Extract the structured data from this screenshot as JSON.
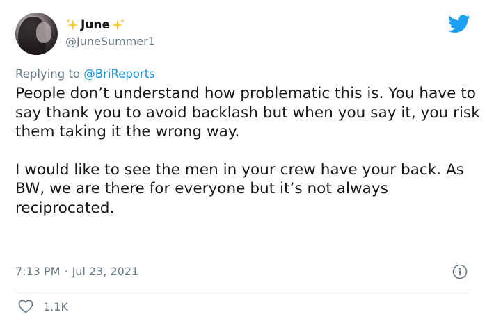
{
  "author": {
    "display_name": "June",
    "handle": "@JuneSummer1",
    "avatar": "avatar-photo",
    "name_decoration_icon": "sparkles-icon"
  },
  "platform_icon": "twitter-bird-icon",
  "reply": {
    "prefix": "Replying to",
    "mention": "@BriReports"
  },
  "tweet": {
    "paragraphs": [
      "People don’t understand how problematic this is. You have to say thank you to avoid backlash but when you say it, you risk them taking it the wrong way.",
      "I would like to see the men in your crew have your back. As BW, we are there for everyone but it’s not always reciprocated."
    ],
    "time": "7:13 PM",
    "separator": "·",
    "date": "Jul 23, 2021"
  },
  "actions": {
    "like_icon": "heart-icon",
    "like_count": "1.1K",
    "info_icon": "info-icon"
  },
  "colors": {
    "text": "#14171a",
    "muted": "#657786",
    "link": "#1b95e0",
    "twitter_blue": "#1da1f2",
    "sparkle": "#f7c948"
  }
}
